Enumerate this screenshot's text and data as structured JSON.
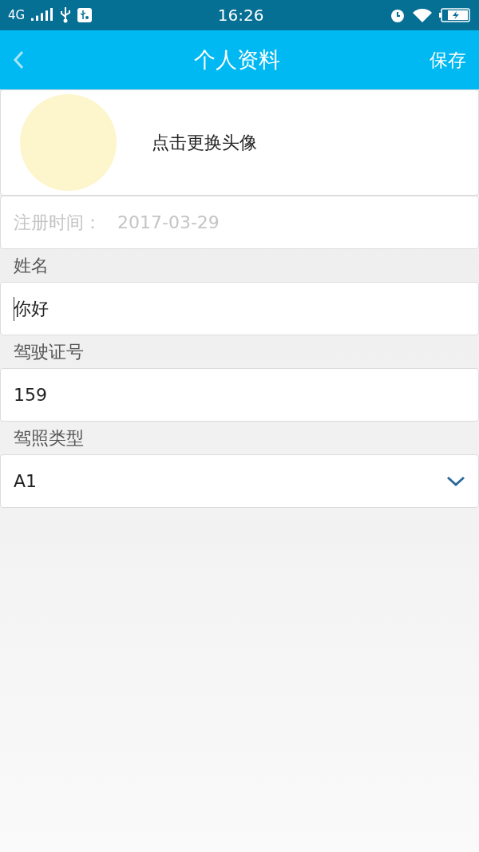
{
  "status_bar": {
    "network": "4G",
    "time": "16:26"
  },
  "header": {
    "title": "个人资料",
    "action": "保存"
  },
  "avatar": {
    "label": "点击更换头像"
  },
  "registration": {
    "label": "注册时间：",
    "value": "2017-03-29"
  },
  "fields": [
    {
      "kind": "text",
      "label": "姓名",
      "value": "你好",
      "focused": true
    },
    {
      "kind": "text",
      "label": "驾驶证号",
      "value": "159",
      "focused": false
    },
    {
      "kind": "select",
      "label": "驾照类型",
      "value": "A1",
      "focused": false
    }
  ]
}
